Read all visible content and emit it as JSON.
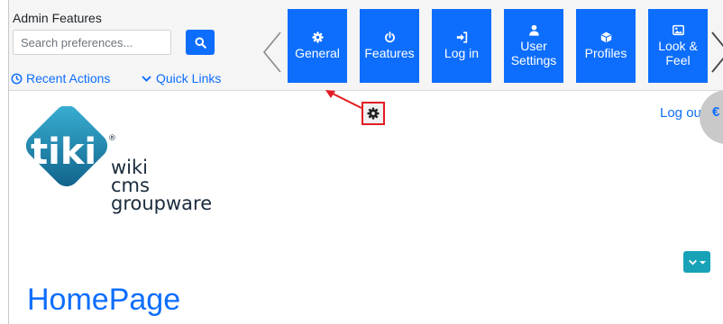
{
  "admin_bar": {
    "title": "Admin Features",
    "search": {
      "placeholder": "Search preferences...",
      "value": ""
    },
    "recent_actions": "Recent Actions",
    "quick_links": "Quick Links",
    "tiles": [
      {
        "label": "General",
        "icon": "gear-icon"
      },
      {
        "label": "Features",
        "icon": "power-icon"
      },
      {
        "label": "Log in",
        "icon": "sign-in-icon"
      },
      {
        "label": "User\nSettings",
        "icon": "user-icon"
      },
      {
        "label": "Profiles",
        "icon": "cube-icon"
      },
      {
        "label": "Look &\nFeel",
        "icon": "image-icon"
      }
    ]
  },
  "site": {
    "logo": {
      "mark": "tiki",
      "lines": [
        "wiki",
        "cms",
        "groupware"
      ]
    },
    "logout": "Log out",
    "page_title": "HomePage"
  },
  "colors": {
    "primary": "#0d6efd",
    "annotation": "#e21c21",
    "logo_teal": "#1a8fb5",
    "info": "#17a2b8"
  }
}
